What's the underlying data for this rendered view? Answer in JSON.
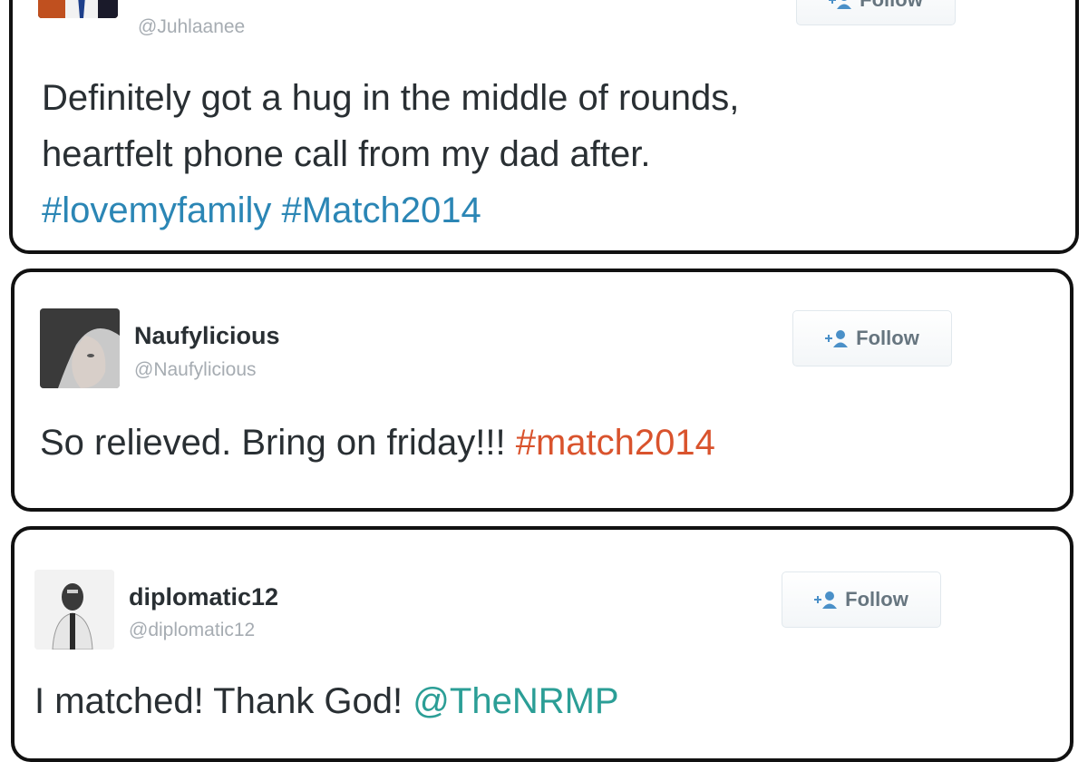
{
  "colors": {
    "card_border": "#111111",
    "name_text": "#292f33",
    "handle_text": "#a6acb2",
    "hashtag_blue": "#2b86b5",
    "hashtag_orange": "#d9532d",
    "mention_teal": "#2b9e96"
  },
  "tweets": [
    {
      "display_name": "",
      "handle": "@Juhlaanee",
      "avatar_icon": "profile-photo-icon",
      "follow_label": "Follow",
      "text_lines": [
        "Definitely got a hug in the middle of rounds,",
        "heartfelt phone call from my dad after."
      ],
      "hashtags": [
        "#lovemyfamily",
        "#Match2014"
      ]
    },
    {
      "display_name": "Naufylicious",
      "handle": "@Naufylicious",
      "avatar_icon": "profile-photo-icon",
      "follow_label": "Follow",
      "text": "So relieved. Bring on friday!!!",
      "hashtag": "#match2014"
    },
    {
      "display_name": "diplomatic12",
      "handle": "@diplomatic12",
      "avatar_icon": "profile-photo-icon",
      "follow_label": "Follow",
      "text": "I matched! Thank God!",
      "mention": "@TheNRMP"
    }
  ]
}
